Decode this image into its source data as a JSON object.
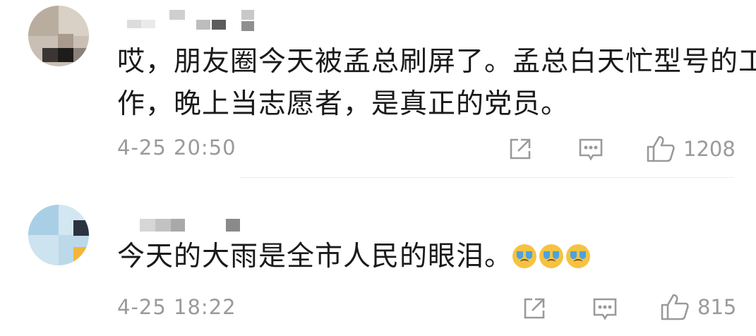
{
  "comments": [
    {
      "text_line1": "哎，朋友圈今天被孟总刷屏了。孟总白天忙型号的工",
      "text_line2": "作，晚上当志愿者，是真正的党员。",
      "time": "4-25 20:50",
      "likes": "1208"
    },
    {
      "text_line1": "今天的大雨是全市人民的眼泪。",
      "emoji_count": 3,
      "time": "4-25 18:22",
      "likes": "815"
    }
  ],
  "icons": {
    "share": "share-icon",
    "reply": "comment-icon",
    "like": "thumbs-up-icon",
    "emoji": "crying-face-icon"
  },
  "colors": {
    "text": "#1a1a1a",
    "meta": "#9a9a9a",
    "divider": "#ececec",
    "emoji_face": "#f5c242",
    "emoji_tears": "#4aa3df"
  }
}
